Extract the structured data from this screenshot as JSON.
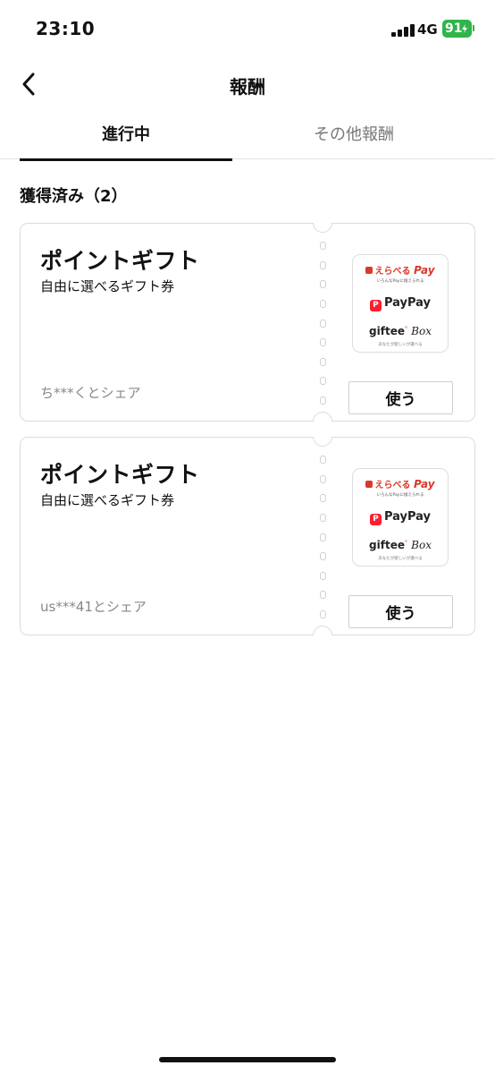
{
  "status_bar": {
    "time": "23:10",
    "network": "4G",
    "battery": "91"
  },
  "header": {
    "title": "報酬",
    "back_icon": "chevron-left-icon"
  },
  "tabs": [
    {
      "label": "進行中",
      "active": true
    },
    {
      "label": "その他報酬",
      "active": false
    }
  ],
  "section": {
    "title": "獲得済み（2）"
  },
  "cards": [
    {
      "title": "ポイントギフト",
      "subtitle": "自由に選べるギフト券",
      "share_text": "ち***くとシェア",
      "brands": {
        "erabe_label": "えらべる",
        "erabe_pay": "Pay",
        "erabe_sub": "いろんなPayに換えられる",
        "paypay_label": "PayPay",
        "giftee_label": "giftee",
        "giftee_box": "Box",
        "giftee_sub": "あなたが欲しいが選べる"
      },
      "button_label": "使う"
    },
    {
      "title": "ポイントギフト",
      "subtitle": "自由に選べるギフト券",
      "share_text": "us***41とシェア",
      "brands": {
        "erabe_label": "えらべる",
        "erabe_pay": "Pay",
        "erabe_sub": "いろんなPayに換えられる",
        "paypay_label": "PayPay",
        "giftee_label": "giftee",
        "giftee_box": "Box",
        "giftee_sub": "あなたが欲しいが選べる"
      },
      "button_label": "使う"
    }
  ],
  "colors": {
    "battery": "#2fb54a",
    "erabe_red": "#d93a2b",
    "paypay_red": "#ff1e2d",
    "border": "#dcdcdc"
  }
}
